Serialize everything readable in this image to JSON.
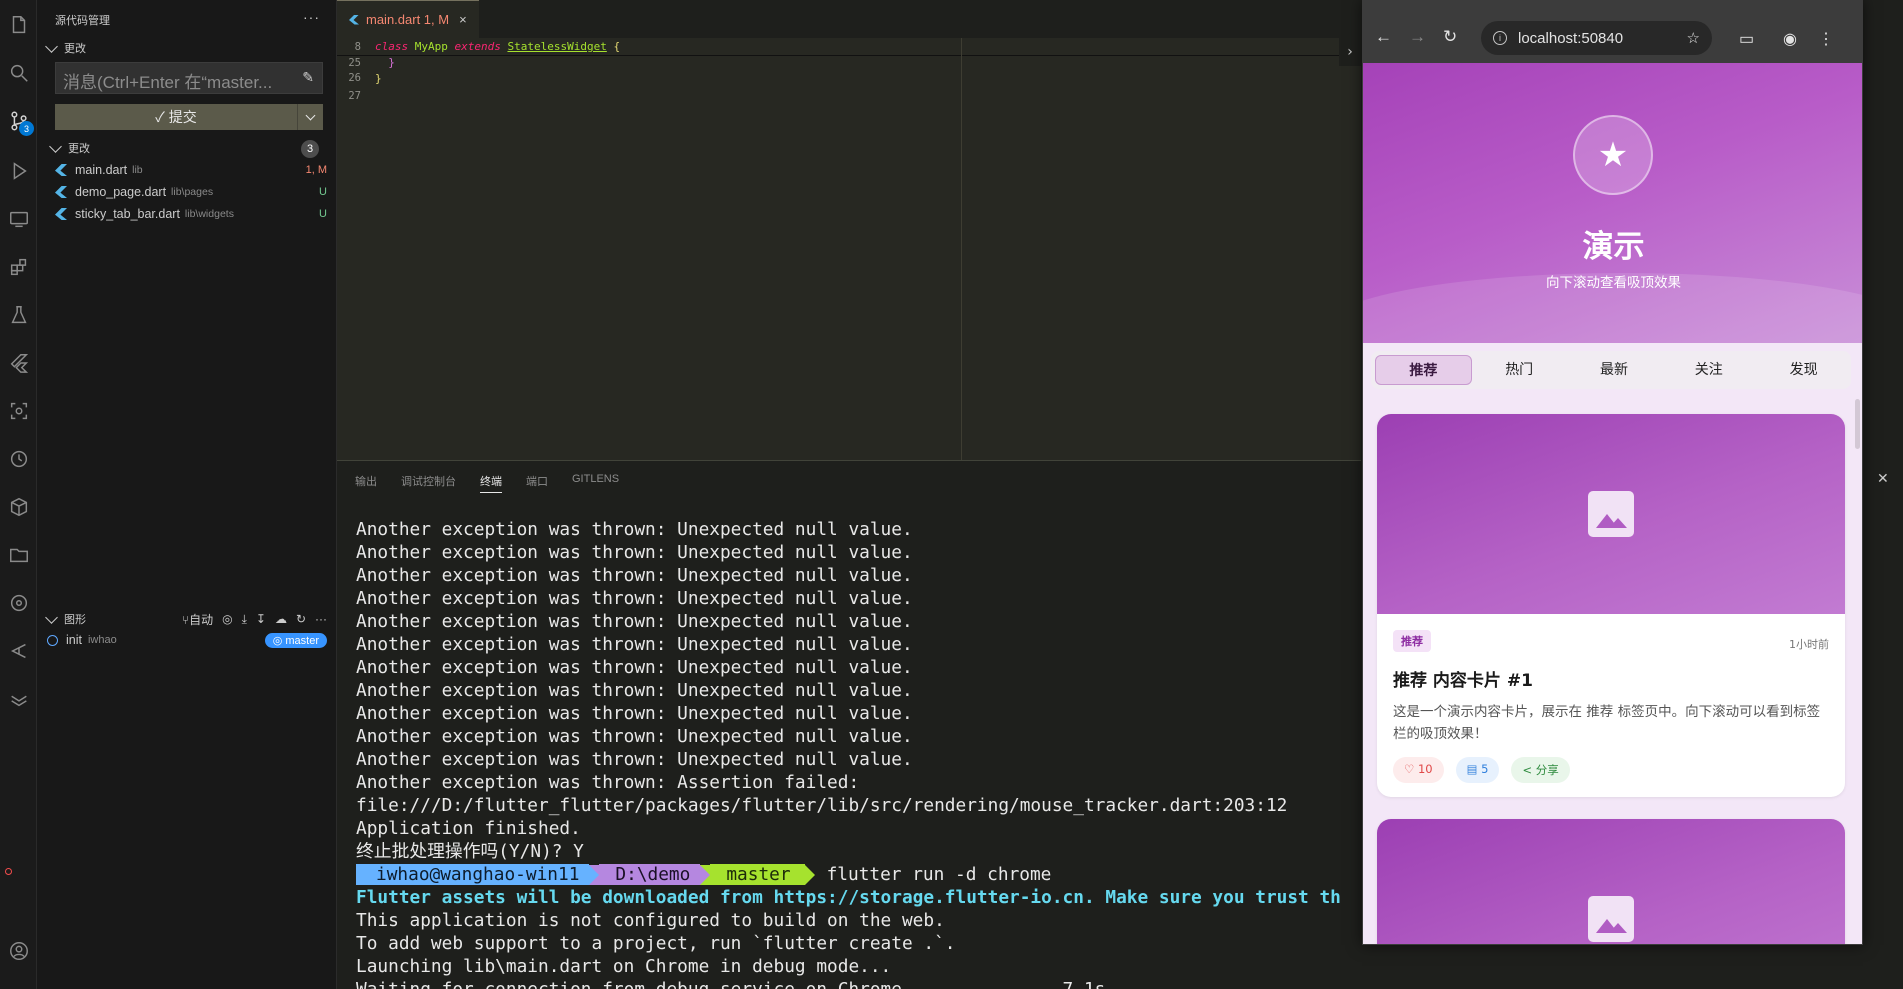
{
  "activity_bar": {
    "scm_badge": "3"
  },
  "sidebar": {
    "title": "源代码管理",
    "more": "···",
    "changes_header": "更改",
    "commit_placeholder": "消息(Ctrl+Enter 在“master...",
    "commit_button": "✓ 提交",
    "changes_group": "更改",
    "changes_count": "3",
    "files": [
      {
        "name": "main.dart",
        "path": "lib",
        "status": "1, M"
      },
      {
        "name": "demo_page.dart",
        "path": "lib\\pages",
        "status": "U"
      },
      {
        "name": "sticky_tab_bar.dart",
        "path": "lib\\widgets",
        "status": "U"
      }
    ],
    "graph_header": "图形",
    "graph_auto": "自动",
    "graph_commit": {
      "message": "init",
      "author": "iwhao",
      "branch": "master"
    }
  },
  "editor": {
    "tab_label": "main.dart 1, M",
    "tab_close": "×",
    "lines": [
      {
        "num": "8"
      },
      {
        "num": "25",
        "text": "  }"
      },
      {
        "num": "26",
        "text": "}"
      },
      {
        "num": "27",
        "text": ""
      }
    ],
    "sticky_kw1": "class",
    "sticky_name": "MyApp",
    "sticky_kw2": "extends",
    "sticky_super": "StatelessWidget",
    "sticky_brace": "{"
  },
  "panel": {
    "tabs": [
      "输出",
      "调试控制台",
      "终端",
      "端口",
      "GITLENS"
    ],
    "active_tab": "终端",
    "terminal_lines": [
      "Another exception was thrown: Unexpected null value.",
      "Another exception was thrown: Unexpected null value.",
      "Another exception was thrown: Unexpected null value.",
      "Another exception was thrown: Unexpected null value.",
      "Another exception was thrown: Unexpected null value.",
      "Another exception was thrown: Unexpected null value.",
      "Another exception was thrown: Unexpected null value.",
      "Another exception was thrown: Unexpected null value.",
      "Another exception was thrown: Unexpected null value.",
      "Another exception was thrown: Unexpected null value.",
      "Another exception was thrown: Unexpected null value.",
      "Another exception was thrown: Assertion failed:",
      "file:///D:/flutter_flutter/packages/flutter/lib/src/rendering/mouse_tracker.dart:203:12",
      "Application finished.",
      "终止批处理操作吗(Y/N)? Y"
    ],
    "prompt_user": "iwhao@wanghao-win11",
    "prompt_dir": "D:\\demo",
    "prompt_branch": "master",
    "prompt_cmd": "flutter run -d chrome",
    "after_lines": [
      {
        "text": "Flutter assets will be downloaded from https://storage.flutter-io.cn. Make sure you trust th",
        "style": "cyan"
      },
      {
        "text": "This application is not configured to build on the web.",
        "style": ""
      },
      {
        "text": "To add web support to a project, run `flutter create .`.",
        "style": ""
      },
      {
        "text": "Launching lib\\main.dart on Chrome in debug mode...",
        "style": ""
      },
      {
        "text": "Waiting for connection from debug service on Chrome...            7.1s",
        "style": ""
      }
    ]
  },
  "browser": {
    "url": "localhost:50840",
    "hero_title": "演示",
    "hero_subtitle": "向下滚动查看吸顶效果",
    "tabs": [
      "推荐",
      "热门",
      "最新",
      "关注",
      "发现"
    ],
    "selected_tab": "推荐",
    "card": {
      "tag": "推荐",
      "time": "1小时前",
      "title": "推荐 内容卡片 #1",
      "desc": "这是一个演示内容卡片，展示在 推荐 标签页中。向下滚动可以看到标签栏的吸顶效果！",
      "likes": "♡ 10",
      "comments": "▤ 5",
      "share": "< 分享"
    }
  }
}
